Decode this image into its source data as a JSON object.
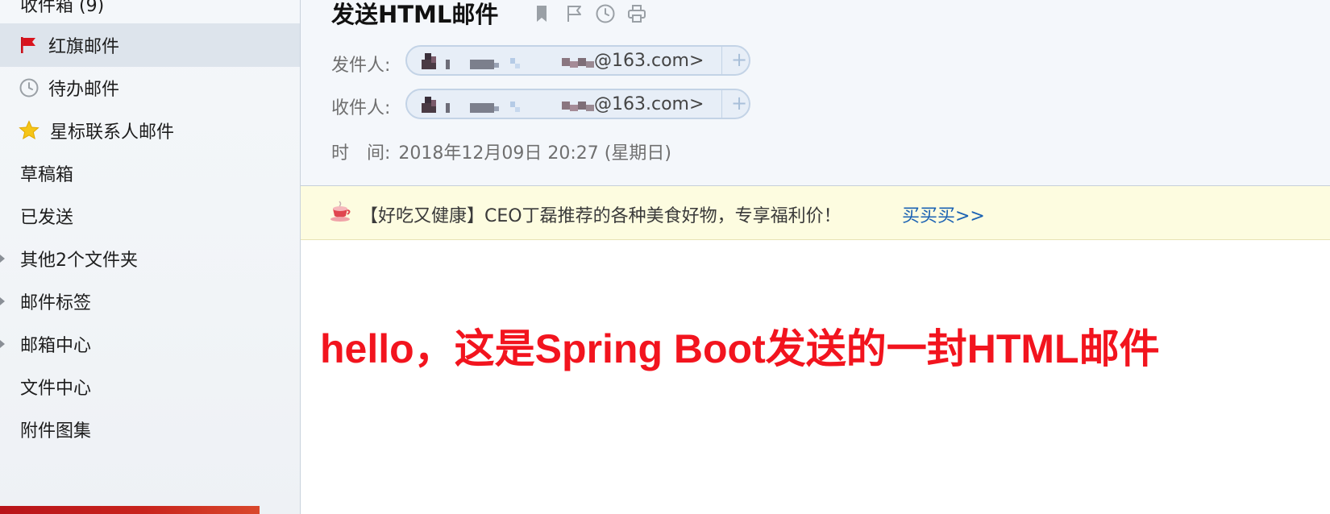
{
  "sidebar": {
    "items": [
      {
        "label": "收件箱 (9)"
      },
      {
        "label": "红旗邮件",
        "icon": "red-flag-icon"
      },
      {
        "label": "待办邮件",
        "icon": "clock-icon"
      },
      {
        "label": "星标联系人邮件",
        "icon": "star-icon"
      },
      {
        "label": "草稿箱"
      },
      {
        "label": "已发送"
      },
      {
        "label": "其他2个文件夹"
      },
      {
        "label": "邮件标签"
      },
      {
        "label": "邮箱中心"
      },
      {
        "label": "文件中心"
      },
      {
        "label": "附件图集"
      }
    ],
    "active_item": "红旗邮件"
  },
  "header": {
    "title": "发送HTML邮件",
    "toolbar_icons": [
      "bookmark-icon",
      "flag-icon",
      "clock-icon",
      "print-icon"
    ],
    "sender_label": "发件人:",
    "sender_email": "@163.com>",
    "recipient_label": "收件人:",
    "recipient_email": "@163.com>",
    "add_symbol": "+",
    "time_label": "时　间:",
    "time_value": "2018年12月09日 20:27 (星期日)"
  },
  "ad": {
    "text": "【好吃又健康】CEO丁磊推荐的各种美食好物，专享福利价！",
    "link": "买买买>>"
  },
  "mail_body": {
    "heading": "hello，这是Spring Boot发送的一封HTML邮件"
  },
  "colors": {
    "heading_red": "#f2141e",
    "link_blue": "#1b62b3",
    "active_item_bg": "#dde4ec",
    "ad_bg": "#fdfce0"
  }
}
